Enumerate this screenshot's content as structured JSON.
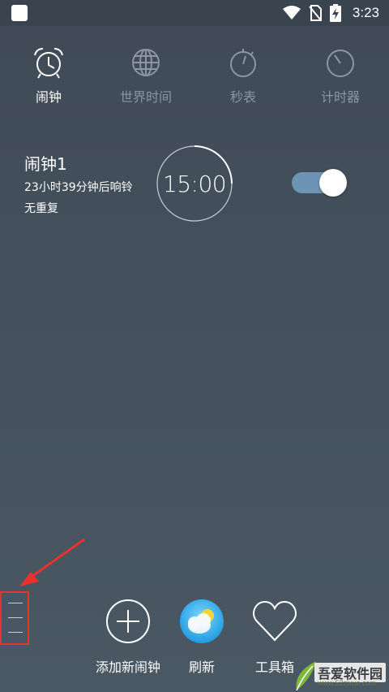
{
  "status_bar": {
    "time": "3:23",
    "icons": [
      "app-icon",
      "wifi-icon",
      "no-sim-icon",
      "battery-charging-icon"
    ]
  },
  "tabs": [
    {
      "label": "闹钟",
      "icon": "alarm-clock-icon",
      "active": true
    },
    {
      "label": "世界时间",
      "icon": "globe-icon",
      "active": false
    },
    {
      "label": "秒表",
      "icon": "stopwatch-icon",
      "active": false
    },
    {
      "label": "计时器",
      "icon": "timer-icon",
      "active": false
    }
  ],
  "alarm": {
    "title": "闹钟1",
    "remaining": "23小时39分钟后响铃",
    "repeat": "无重复",
    "time": "15:00",
    "enabled": true
  },
  "bottom_bar": {
    "add_label": "添加新闹钟",
    "refresh_label": "刷新",
    "toolbox_label": "工具箱"
  },
  "watermark": {
    "text": "吾爱软件园",
    "url": "www.52zixue.com"
  },
  "colors": {
    "background": "#46535f",
    "toggle_track": "#6c94b4",
    "annotation": "#e8322b",
    "inactive_tab": "#8b96a2"
  }
}
